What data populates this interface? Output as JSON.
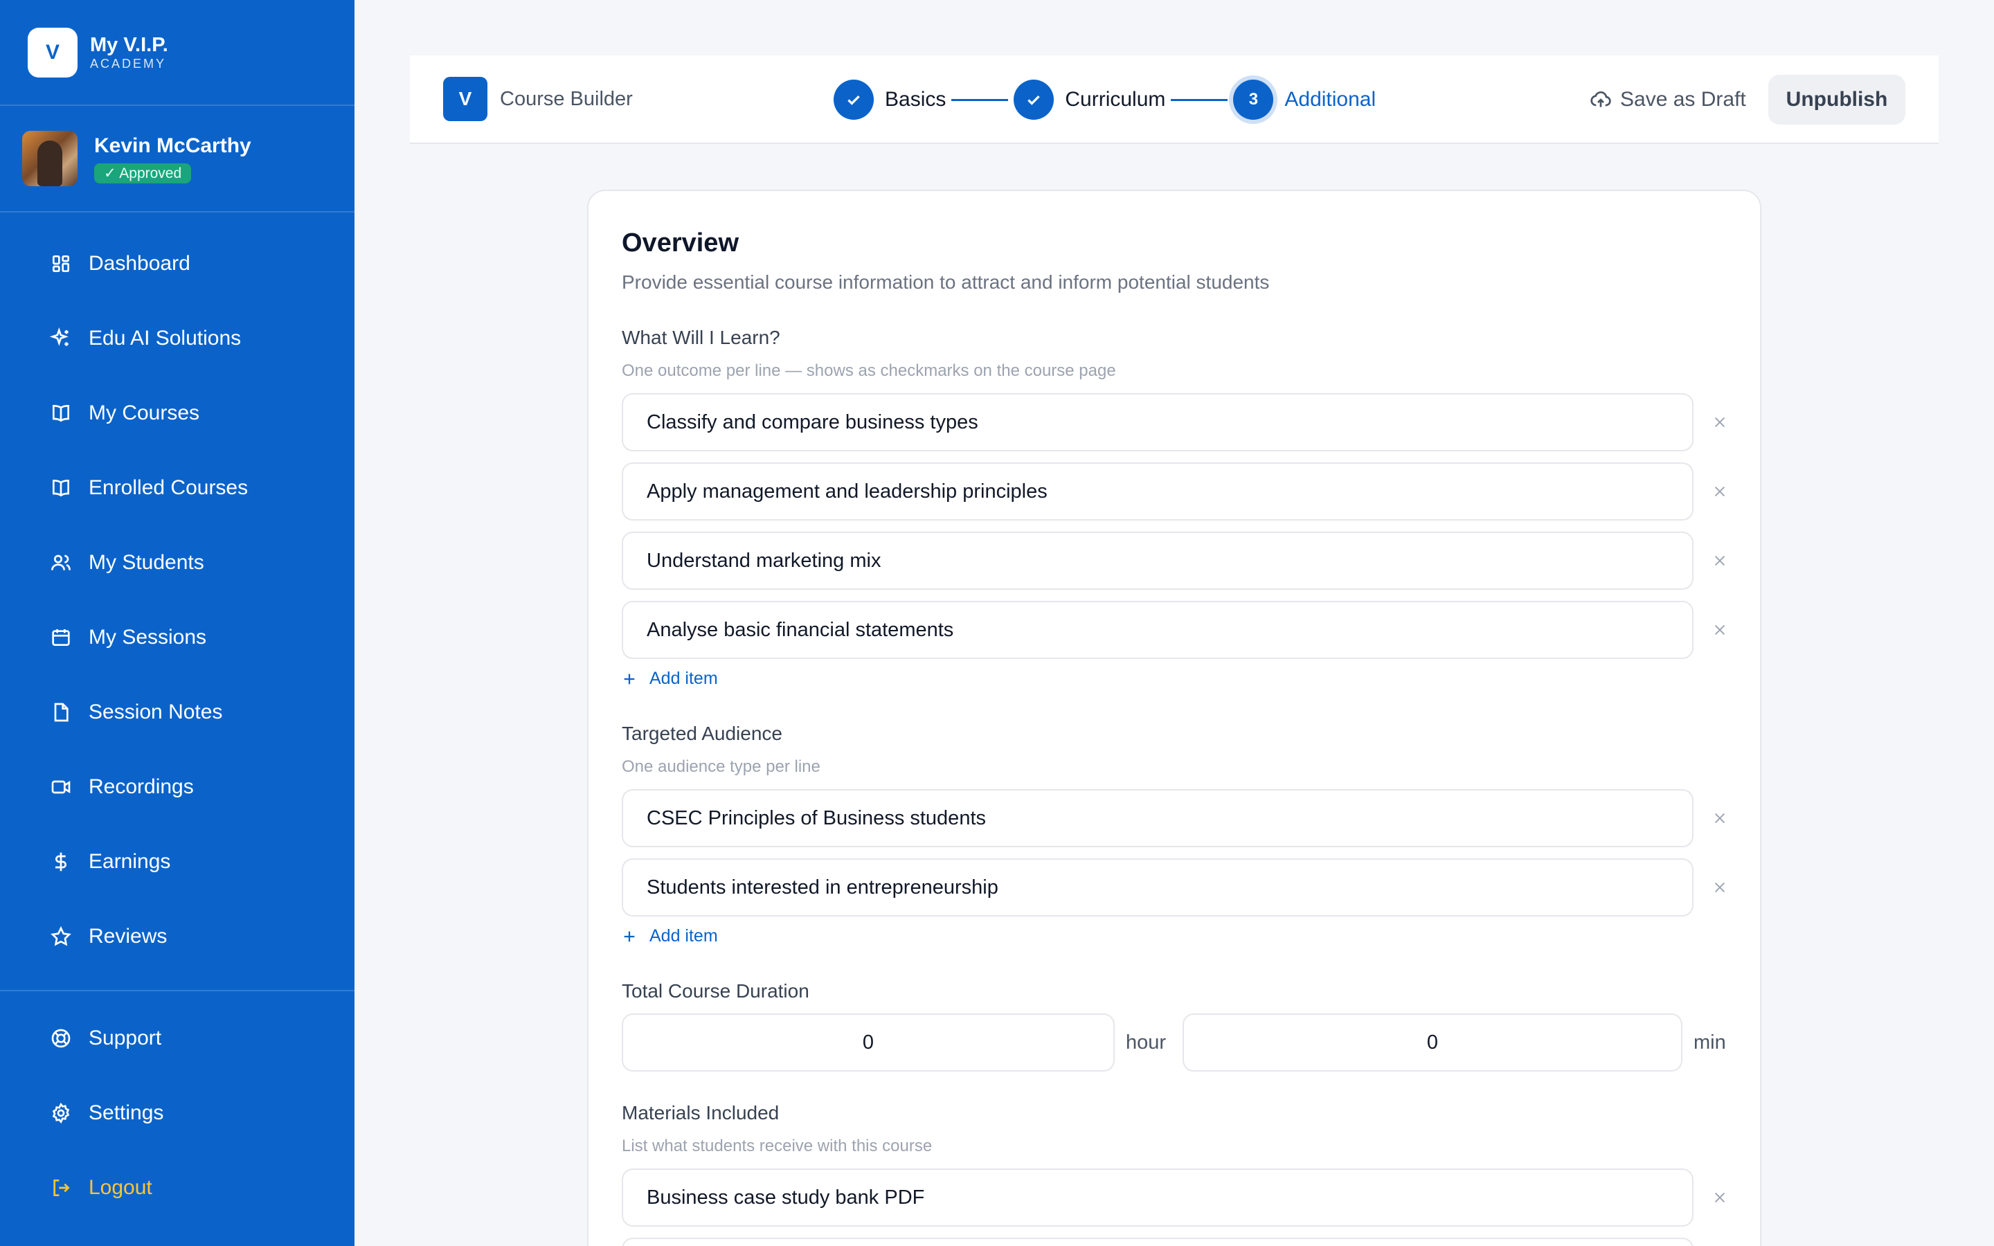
{
  "brand": {
    "logo_letter": "V",
    "name": "My V.I.P.",
    "sub": "ACADEMY"
  },
  "profile": {
    "name": "Kevin McCarthy",
    "badge": "✓ Approved"
  },
  "nav": {
    "items": [
      {
        "label": "Dashboard",
        "icon": "dashboard-icon"
      },
      {
        "label": "Edu AI Solutions",
        "icon": "sparkles-icon"
      },
      {
        "label": "My Courses",
        "icon": "book-icon"
      },
      {
        "label": "Enrolled Courses",
        "icon": "book-icon"
      },
      {
        "label": "My Students",
        "icon": "users-icon"
      },
      {
        "label": "My Sessions",
        "icon": "calendar-icon"
      },
      {
        "label": "Session Notes",
        "icon": "file-icon"
      },
      {
        "label": "Recordings",
        "icon": "video-icon"
      },
      {
        "label": "Earnings",
        "icon": "dollar-icon"
      },
      {
        "label": "Reviews",
        "icon": "star-icon"
      }
    ],
    "bottom": [
      {
        "label": "Support",
        "icon": "lifebuoy-icon"
      },
      {
        "label": "Settings",
        "icon": "gear-icon"
      },
      {
        "label": "Logout",
        "icon": "logout-icon",
        "color": "#ffc533"
      }
    ]
  },
  "topbar": {
    "logo_letter": "V",
    "title": "Course Builder",
    "steps": [
      {
        "label": "Basics",
        "state": "done"
      },
      {
        "label": "Curriculum",
        "state": "done"
      },
      {
        "label": "Additional",
        "number": "3",
        "state": "active"
      }
    ],
    "save_draft": "Save as Draft",
    "unpublish": "Unpublish"
  },
  "overview": {
    "title": "Overview",
    "subtitle": "Provide essential course information to attract and inform potential students",
    "learn": {
      "label": "What Will I Learn?",
      "hint": "One outcome per line — shows as checkmarks on the course page",
      "items": [
        "Classify and compare business types",
        "Apply management and leadership principles",
        "Understand marketing mix",
        "Analyse basic financial statements"
      ],
      "add_label": "Add item"
    },
    "audience": {
      "label": "Targeted Audience",
      "hint": "One audience type per line",
      "items": [
        "CSEC Principles of Business students",
        "Students interested in entrepreneurship"
      ],
      "add_label": "Add item"
    },
    "duration": {
      "label": "Total Course Duration",
      "hours": "0",
      "hour_unit": "hour",
      "minutes": "0",
      "min_unit": "min"
    },
    "materials": {
      "label": "Materials Included",
      "hint": "List what students receive with this course",
      "items": [
        "Business case study bank PDF"
      ]
    }
  },
  "colors": {
    "primary": "#0b63c9",
    "accent": "#ffc533",
    "approved": "#1aa57a"
  }
}
